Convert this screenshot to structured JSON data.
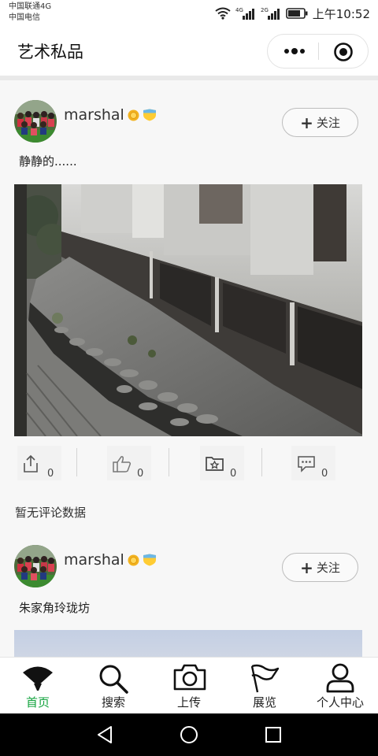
{
  "status_bar": {
    "carrier_1": "中国联通4G",
    "carrier_2": "中国电信",
    "signal_1_tag": "4G",
    "signal_2_tag": "2G",
    "time": "上午10:52"
  },
  "header": {
    "title": "艺术私品"
  },
  "posts": [
    {
      "username": "marshal",
      "follow_label": "关注",
      "text": "静静的......",
      "actions": {
        "share_count": "0",
        "like_count": "0",
        "favorite_count": "0",
        "comment_count": "0"
      },
      "no_comments": "暂无评论数据"
    },
    {
      "username": "marshal",
      "follow_label": "关注",
      "text": "朱家角玲珑坊"
    }
  ],
  "tabbar": {
    "items": [
      {
        "label": "首页",
        "icon": "home-fan-icon",
        "active": true
      },
      {
        "label": "搜索",
        "icon": "search-icon"
      },
      {
        "label": "上传",
        "icon": "camera-icon"
      },
      {
        "label": "展览",
        "icon": "flag-icon"
      },
      {
        "label": "个人中心",
        "icon": "user-icon"
      }
    ],
    "active_color": "#12a33d"
  }
}
